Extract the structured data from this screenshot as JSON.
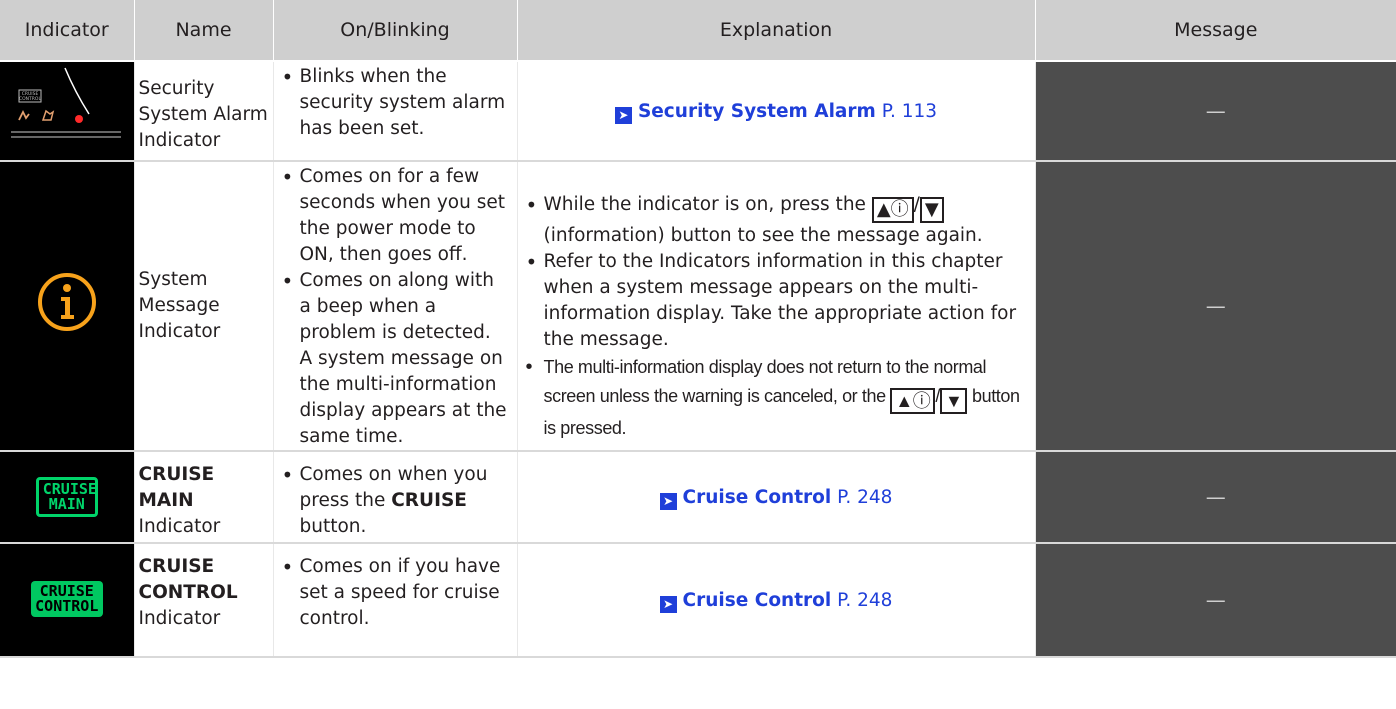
{
  "headers": {
    "indicator": "Indicator",
    "name": "Name",
    "on_blinking": "On/Blinking",
    "explanation": "Explanation",
    "message": "Message"
  },
  "rows": [
    {
      "icon": "security-system-alarm-icon",
      "name": "Security System Alarm Indicator",
      "on_blinking": [
        "Blinks when the security system alarm has been set."
      ],
      "link_text": "Security System Alarm",
      "link_page": "P. 113",
      "message": "—"
    },
    {
      "icon": "system-message-icon",
      "name": "System Message Indicator",
      "on_blinking": [
        "Comes on for a few seconds when you set the power mode to ON, then goes off.",
        "Comes on along with a beep when a problem is detected. A system message on the multi-information display appears at the same time."
      ],
      "explanation": {
        "b1_a": "While the indicator is on, press the",
        "b1_b": "(information) button to see the message again.",
        "b2": "Refer to the Indicators information in this chapter when a system message appears on the multi-information display. Take the appropriate action for the message.",
        "b3_a": "The multi-information display does not return to the normal screen unless the warning is canceled, or the",
        "b3_b": "button is pressed.",
        "btn_up": "▲ⓘ",
        "btn_sep": "/",
        "btn_down": "▼"
      },
      "message": "—"
    },
    {
      "icon": "cruise-main-icon",
      "icon_text": "CRUISE MAIN",
      "name_bold": "CRUISE MAIN",
      "name_rest": "Indicator",
      "on_blinking_a": "Comes on when you press the",
      "on_blinking_bold": "CRUISE",
      "on_blinking_b": "button.",
      "link_text": "Cruise Control",
      "link_page": "P. 248",
      "message": "—"
    },
    {
      "icon": "cruise-control-icon",
      "icon_text": "CRUISE CONTROL",
      "name_bold": "CRUISE CONTROL",
      "name_rest": "Indicator",
      "on_blinking": [
        "Comes on if you have set a speed for cruise control."
      ],
      "link_text": "Cruise Control",
      "link_page": "P. 248",
      "message": "—"
    }
  ],
  "colors": {
    "header_bg": "#cfcfcf",
    "message_bg": "#4d4d4d",
    "link": "#1f3fd9",
    "cruise_green": "#00d46a",
    "info_orange": "#f7a21b"
  }
}
